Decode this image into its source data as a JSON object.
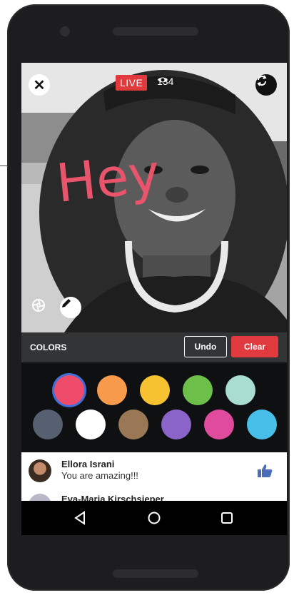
{
  "stream": {
    "live_label": "LIVE",
    "viewer_count": "134",
    "drawing_text": "Hey",
    "close_icon": "close-icon",
    "flip_icon": "camera-flip-icon",
    "filter_icon": "filter-icon",
    "pen_icon": "pen-icon"
  },
  "toolbar": {
    "colors_label": "COLORS",
    "undo_label": "Undo",
    "clear_label": "Clear"
  },
  "palette": {
    "selected": "#ef4b6a",
    "row1": [
      "#ef4b6a",
      "#f79a4b",
      "#f7c232",
      "#6cc04a",
      "#a9ddd1"
    ],
    "row2": [
      "#566070",
      "#ffffff",
      "#9a7856",
      "#8a64c8",
      "#e04b9e",
      "#47bfe8"
    ]
  },
  "comments": [
    {
      "name": "Ellora Israni",
      "text": "You are amazing!!!"
    },
    {
      "name": "Eva-Maria Kirschsieper",
      "text": ""
    }
  ],
  "colors": {
    "live_red": "#e03a3e",
    "like_blue": "#4b6cb7",
    "drawing_pink": "#e8546c"
  }
}
